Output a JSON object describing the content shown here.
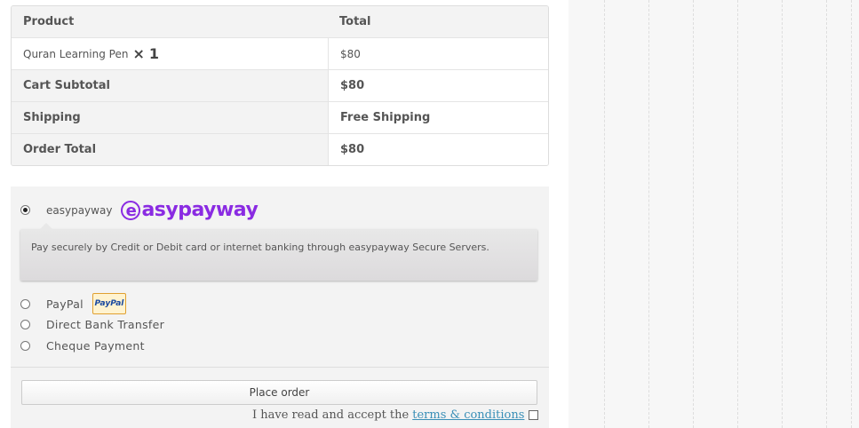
{
  "order": {
    "head": {
      "product": "Product",
      "total": "Total"
    },
    "item": {
      "name": "Quran Learning Pen",
      "times": "×",
      "qty": "1",
      "total": "$80"
    },
    "subtotal": {
      "label": "Cart Subtotal",
      "value": "$80"
    },
    "shipping": {
      "label": "Shipping",
      "value": "Free Shipping"
    },
    "order_total": {
      "label": "Order Total",
      "value": "$80"
    }
  },
  "payment": {
    "methods": [
      {
        "label": "easypayway",
        "logo": "easypayway",
        "checked": true
      },
      {
        "label": "PayPal",
        "badge": "PayPal",
        "checked": false
      },
      {
        "label": "Direct Bank Transfer",
        "checked": false
      },
      {
        "label": "Cheque Payment",
        "checked": false
      }
    ],
    "description": "Pay securely by Credit or Debit card or internet banking through easypayway Secure Servers.",
    "place_order": "Place order",
    "terms_prefix": "I have read and accept the",
    "terms_link": "terms & conditions"
  }
}
